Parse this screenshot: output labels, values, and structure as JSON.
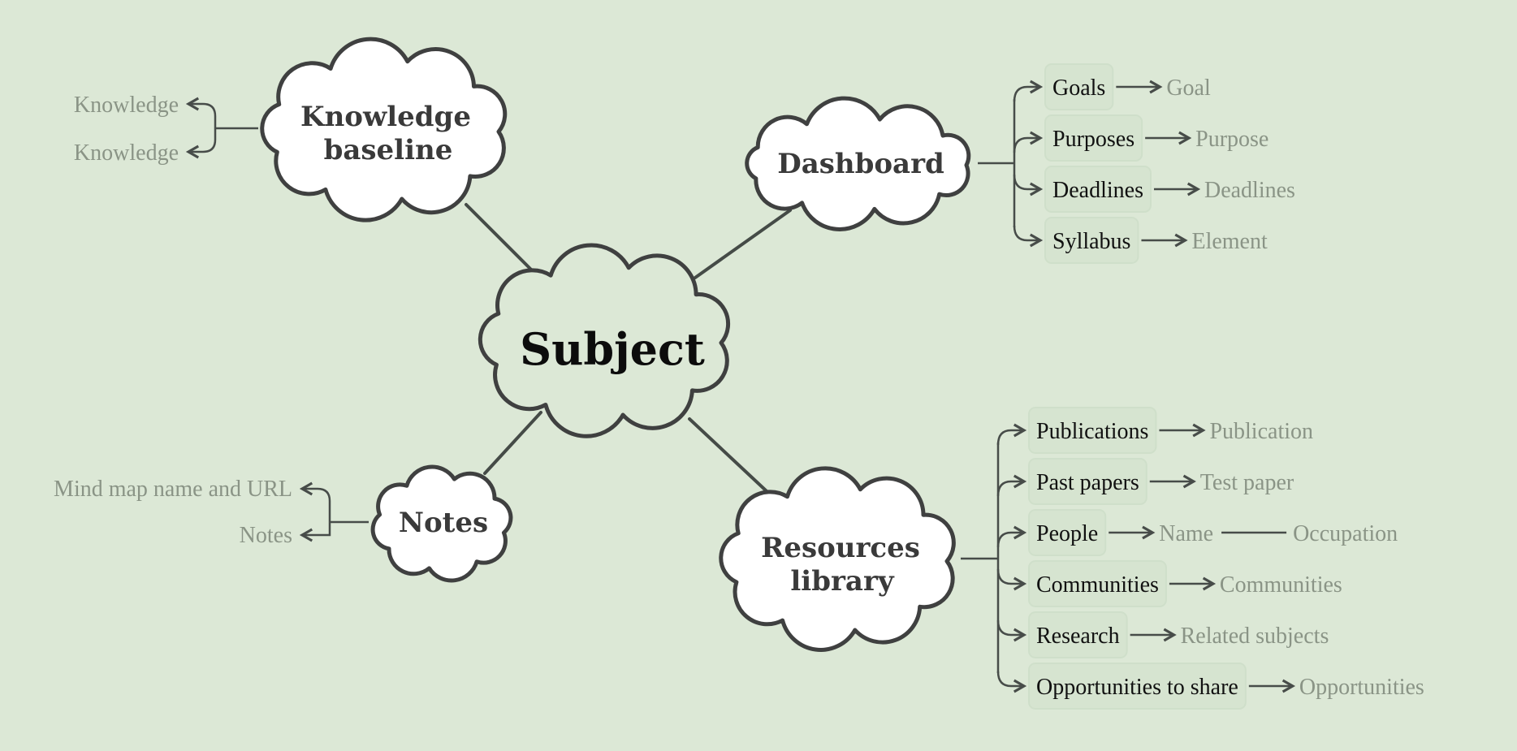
{
  "colors": {
    "background": "#dce8d6",
    "line": "#454b47",
    "child_text": "#111111",
    "leaf_text": "#8a9486",
    "cloud_fill": "#ffffff",
    "cloud_stroke": "#3f4040"
  },
  "central": {
    "title": "Subject"
  },
  "topics": {
    "knowledge": {
      "title_lines": [
        "Knowledge",
        "baseline"
      ],
      "children": [
        {
          "label": "Knowledge"
        },
        {
          "label": "Knowledge"
        }
      ]
    },
    "dashboard": {
      "title_lines": [
        "Dashboard"
      ],
      "children": [
        {
          "label": "Goals",
          "leaf": "Goal"
        },
        {
          "label": "Purposes",
          "leaf": "Purpose"
        },
        {
          "label": "Deadlines",
          "leaf": "Deadlines"
        },
        {
          "label": "Syllabus",
          "leaf": "Element"
        }
      ]
    },
    "notes": {
      "title_lines": [
        "Notes"
      ],
      "children": [
        {
          "label": "Mind map name and URL"
        },
        {
          "label": "Notes"
        }
      ]
    },
    "resources": {
      "title_lines": [
        "Resources",
        "library"
      ],
      "children": [
        {
          "label": "Publications",
          "leaf": "Publication"
        },
        {
          "label": "Past papers",
          "leaf": "Test paper"
        },
        {
          "label": "People",
          "leaf": "Name",
          "leaf2": "Occupation"
        },
        {
          "label": "Communities",
          "leaf": "Communities"
        },
        {
          "label": "Research",
          "leaf": "Related subjects"
        },
        {
          "label": "Opportunities to share",
          "leaf": "Opportunities"
        }
      ]
    }
  }
}
